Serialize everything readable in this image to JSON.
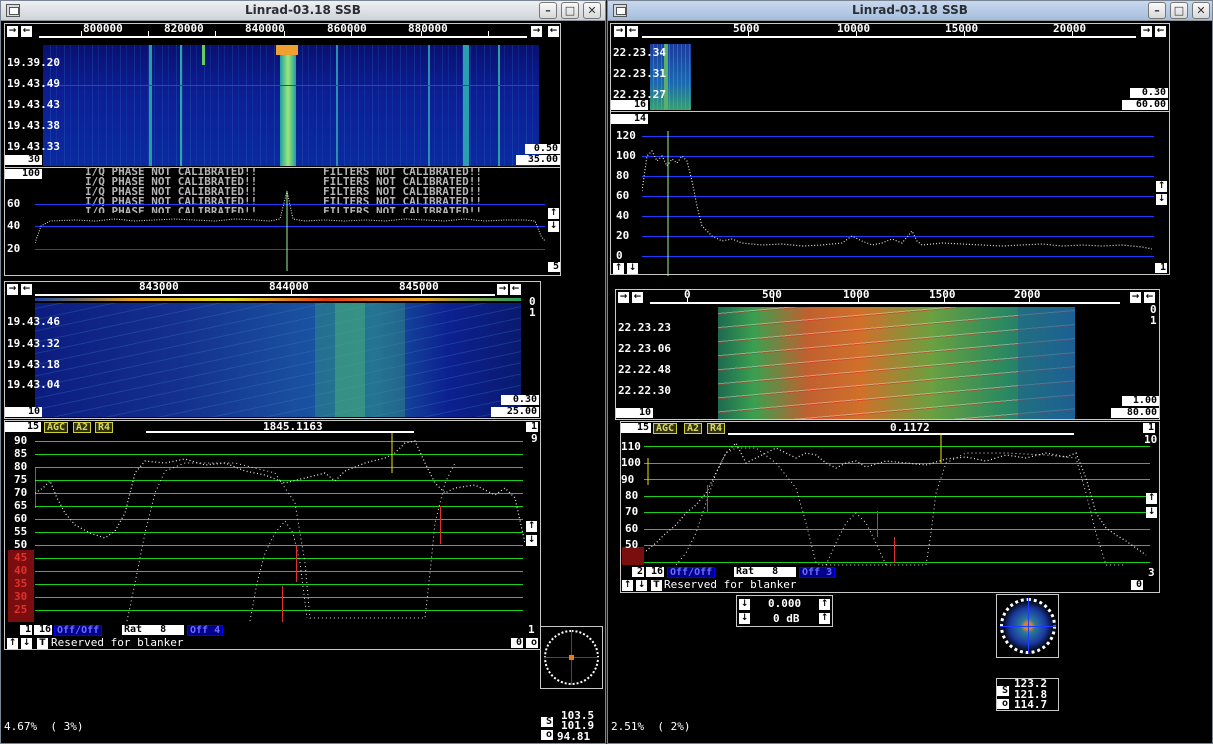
{
  "left": {
    "title": "Linrad-03.18 SSB",
    "wide_ruler": [
      "800000",
      "820000",
      "840000",
      "860000",
      "880000"
    ],
    "wide_times": [
      "19.39.20",
      "19.43.49",
      "19.43.43",
      "19.43.38",
      "19.43.33"
    ],
    "wide_avg": "30",
    "wide_zoom": "0.50",
    "wide_gain": "35.00",
    "spec_avg": "100",
    "warnings": [
      "I/Q PHASE NOT CALIBRATED!!",
      "FILTERS NOT CALIBRATED!!"
    ],
    "spec_y": [
      "60",
      "40",
      "20"
    ],
    "spec_scale": "5",
    "hires_ruler": [
      "843000",
      "844000",
      "845000"
    ],
    "hires_times": [
      "19.43.46",
      "19.43.32",
      "19.43.18",
      "19.43.04"
    ],
    "hires_zero": "0",
    "hires_one": "1",
    "hires_avg": "10",
    "hires_zoom": "0.30",
    "hires_gain": "25.00",
    "base_num": "15",
    "agc": "AGC",
    "a2": "A2",
    "r4": "R4",
    "freq": "1845.1163",
    "base_1": "1",
    "base_9": "9",
    "base_y": [
      "90",
      "85",
      "80",
      "75",
      "70",
      "65",
      "60",
      "55",
      "50",
      "45",
      "40",
      "35",
      "30",
      "25"
    ],
    "bot_1": "1",
    "bot_1b": "1",
    "bot_16": "16",
    "offoff": "Off/Off",
    "rat": "Rat   8",
    "off4": "Off   4",
    "blanker": "Reserved for blanker",
    "bot_0": "0",
    "bot_o": "o",
    "load": "4.67%  ( 3%)",
    "s": "103.5",
    "sq": "101.9",
    "o": "94.81",
    "s_lbl": "S",
    "o_lbl": "o"
  },
  "right": {
    "title": "Linrad-03.18 SSB",
    "wide_ruler": [
      "5000",
      "10000",
      "15000",
      "20000"
    ],
    "wide_times": [
      "22.23.34",
      "22.23.31",
      "22.23.27"
    ],
    "wide_avg": "16",
    "wide_zoom": "0.30",
    "wide_gain": "60.00",
    "spec_avg": "14",
    "spec_y": [
      "120",
      "100",
      "80",
      "60",
      "40",
      "20",
      "0"
    ],
    "spec_scale": "1",
    "hires_ruler": [
      "0",
      "500",
      "1000",
      "1500",
      "2000"
    ],
    "hires_times": [
      "22.23.23",
      "22.23.06",
      "22.22.48",
      "22.22.30"
    ],
    "hires_zero": "0",
    "hires_one": "1",
    "hires_avg": "10",
    "hires_zoom": "1.00",
    "hires_gain": "80.00",
    "base_num": "15",
    "agc": "AGC",
    "a2": "A2",
    "r4": "R4",
    "freq": "0.1172",
    "base_1": "1",
    "base_10": "10",
    "base_y": [
      "110",
      "100",
      "90",
      "80",
      "70",
      "60",
      "50"
    ],
    "bot_2": "2",
    "bot_16": "16",
    "offoff": "Off/Off",
    "rat": "Rat   8",
    "off3": "Off   3",
    "bot_3": "3",
    "blanker": "Reserved for blanker",
    "bot_0": "0",
    "gain1": "0.000",
    "gain2": "0 dB",
    "load": "2.51%  ( 2%)",
    "s": "123.2",
    "sq": "121.8",
    "o": "114.7",
    "s_lbl": "S",
    "o_lbl": "o"
  },
  "colors": {
    "grid_blue": "#1e3cff",
    "grid_green": "#18d018",
    "wf_blue": "#0a1a90",
    "marker_red": "#e03030",
    "cursor_yellow": "#e8e800"
  }
}
